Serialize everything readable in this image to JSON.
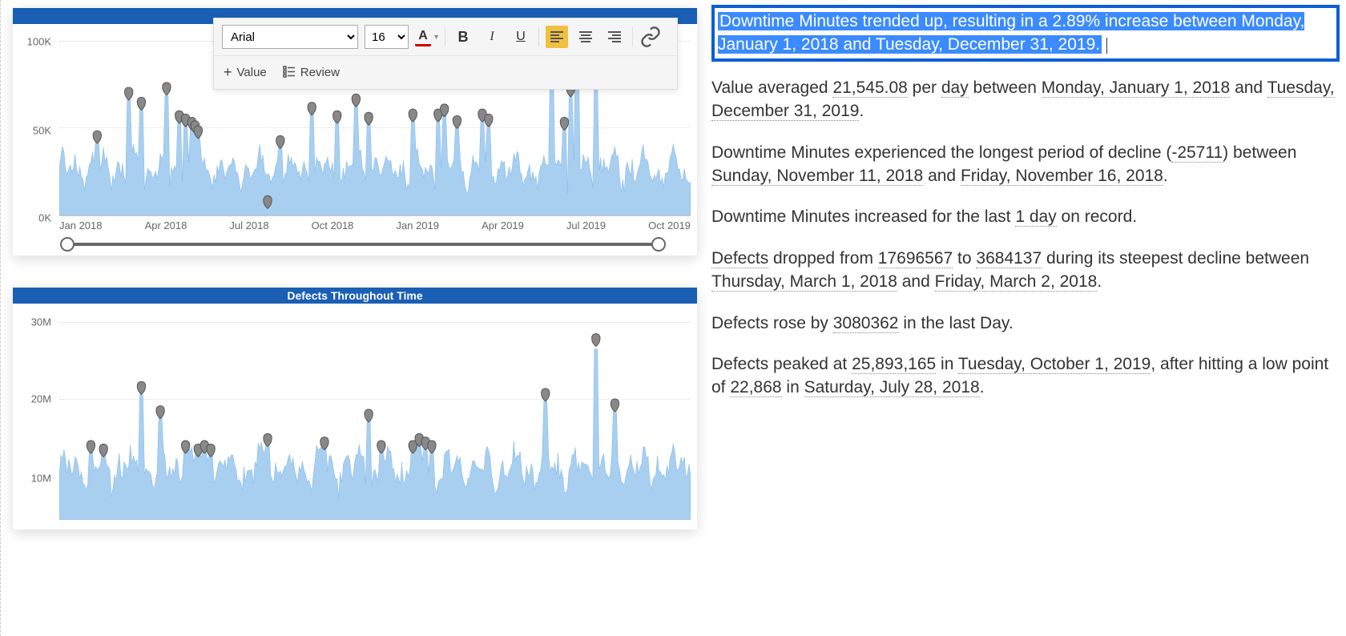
{
  "toolbar": {
    "font_family": "Arial",
    "font_size": "16",
    "value_btn": "Value",
    "review_btn": "Review"
  },
  "chart1": {
    "title": "",
    "y_ticks": [
      "100K",
      "50K",
      "0K"
    ],
    "x_ticks": [
      "Jan 2018",
      "Apr 2018",
      "Jul 2018",
      "Oct 2018",
      "Jan 2019",
      "Apr 2019",
      "Jul 2019",
      "Oct 2019"
    ]
  },
  "chart2": {
    "title": "Defects Throughout Time",
    "y_ticks": [
      "30M",
      "20M",
      "10M"
    ]
  },
  "insights": {
    "highlight": "Downtime Minutes trended up, resulting in a 2.89% increase between Monday, January 1, 2018 and Tuesday, December 31, 2019.",
    "p2_a": "Value averaged ",
    "p2_v1": "21,545.08",
    "p2_b": " per ",
    "p2_v2": "day",
    "p2_c": " between ",
    "p2_v3": "Monday, January 1, 2018",
    "p2_d": " and ",
    "p2_v4": "Tuesday, December 31, 2019",
    "p2_e": ".",
    "p3_a": "Downtime Minutes experienced the longest period of decline (",
    "p3_v1": "-25711",
    "p3_b": ") between ",
    "p3_v2": "Sunday, November 11, 2018",
    "p3_c": " and ",
    "p3_v3": "Friday, November 16, 2018",
    "p3_d": ".",
    "p4_a": "Downtime Minutes increased for the last ",
    "p4_v1": "1 day",
    "p4_b": " on record.",
    "p5_a": "Defects",
    "p5_b": " dropped from ",
    "p5_v1": "17696567",
    "p5_c": " to ",
    "p5_v2": "3684137",
    "p5_d": " during its steepest decline between ",
    "p5_v3": "Thursday, March 1, 2018",
    "p5_e": " and ",
    "p5_v4": "Friday, March 2, 2018",
    "p5_f": ".",
    "p6_a": "Defects rose by ",
    "p6_v1": "3080362",
    "p6_b": " in the last Day.",
    "p7_a": "Defects peaked at ",
    "p7_v1": "25,893,165",
    "p7_b": " in ",
    "p7_v2": "Tuesday, October 1, 2019",
    "p7_c": ", after hitting a low point of ",
    "p7_v3": "22,868",
    "p7_d": " in ",
    "p7_v4": "Saturday, July 28, 2018",
    "p7_e": "."
  },
  "chart_data": [
    {
      "type": "line",
      "title": "Downtime Minutes",
      "xlabel": "",
      "ylabel": "",
      "ylim": [
        0,
        110000
      ],
      "x_range": [
        "2018-01",
        "2019-12"
      ],
      "markers_approx": [
        {
          "x": 0.06,
          "y": 47000
        },
        {
          "x": 0.11,
          "y": 73000
        },
        {
          "x": 0.13,
          "y": 67000
        },
        {
          "x": 0.17,
          "y": 76000
        },
        {
          "x": 0.19,
          "y": 59000
        },
        {
          "x": 0.2,
          "y": 57000
        },
        {
          "x": 0.21,
          "y": 55000
        },
        {
          "x": 0.215,
          "y": 53000
        },
        {
          "x": 0.22,
          "y": 50000
        },
        {
          "x": 0.33,
          "y": 8000
        },
        {
          "x": 0.35,
          "y": 44000
        },
        {
          "x": 0.4,
          "y": 64000
        },
        {
          "x": 0.44,
          "y": 59000
        },
        {
          "x": 0.47,
          "y": 69000
        },
        {
          "x": 0.49,
          "y": 58000
        },
        {
          "x": 0.56,
          "y": 60000
        },
        {
          "x": 0.6,
          "y": 60000
        },
        {
          "x": 0.61,
          "y": 63000
        },
        {
          "x": 0.63,
          "y": 56000
        },
        {
          "x": 0.67,
          "y": 60000
        },
        {
          "x": 0.68,
          "y": 57000
        },
        {
          "x": 0.78,
          "y": 95000
        },
        {
          "x": 0.8,
          "y": 55000
        },
        {
          "x": 0.81,
          "y": 75000
        },
        {
          "x": 0.85,
          "y": 84000
        },
        {
          "x": 0.82,
          "y": 108000
        }
      ],
      "note": "daily noisy series ~15K–40K baseline with spikes to marker values"
    },
    {
      "type": "line",
      "title": "Defects Throughout Time",
      "xlabel": "",
      "ylabel": "",
      "ylim": [
        0,
        30000000
      ],
      "x_range": [
        "2018-01",
        "2019-12"
      ],
      "markers_approx": [
        {
          "x": 0.05,
          "y": 10500000
        },
        {
          "x": 0.07,
          "y": 10000000
        },
        {
          "x": 0.13,
          "y": 19000000
        },
        {
          "x": 0.16,
          "y": 15500000
        },
        {
          "x": 0.2,
          "y": 10500000
        },
        {
          "x": 0.22,
          "y": 10000000
        },
        {
          "x": 0.23,
          "y": 10500000
        },
        {
          "x": 0.24,
          "y": 10000000
        },
        {
          "x": 0.33,
          "y": 11500000
        },
        {
          "x": 0.42,
          "y": 11000000
        },
        {
          "x": 0.49,
          "y": 15000000
        },
        {
          "x": 0.51,
          "y": 10500000
        },
        {
          "x": 0.56,
          "y": 10500000
        },
        {
          "x": 0.57,
          "y": 11500000
        },
        {
          "x": 0.58,
          "y": 11000000
        },
        {
          "x": 0.59,
          "y": 10500000
        },
        {
          "x": 0.77,
          "y": 18000000
        },
        {
          "x": 0.85,
          "y": 25893165
        },
        {
          "x": 0.88,
          "y": 16500000
        }
      ],
      "note": "daily noisy series ~4M–9M baseline with spikes to marker values"
    }
  ]
}
